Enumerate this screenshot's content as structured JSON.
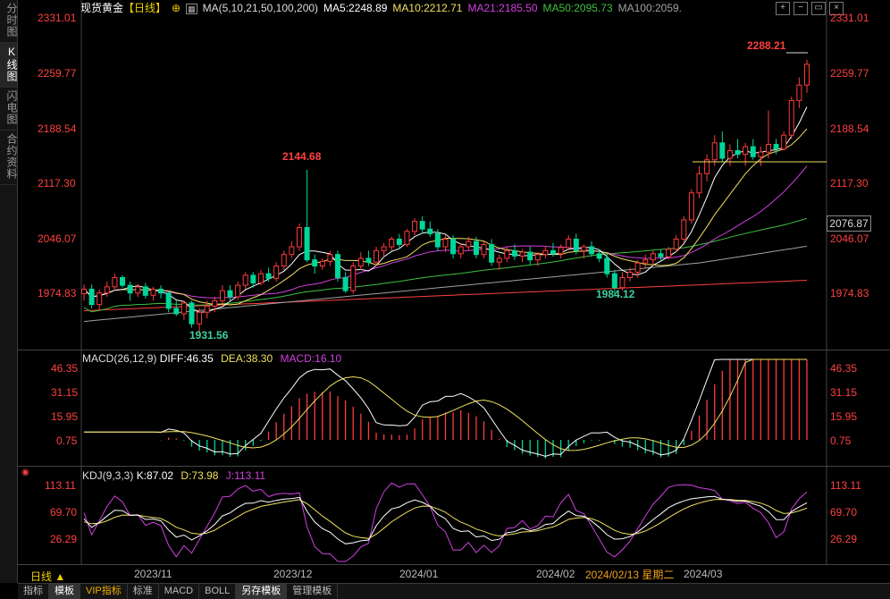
{
  "sidebar": {
    "tabs": [
      "分时图",
      "K线图",
      "闪电图",
      "合约资料"
    ],
    "active": 1
  },
  "header": {
    "title": "现货黄金",
    "period_tag": "【日线】",
    "ma_params": "MA(5,10,21,50,100,200)",
    "ma5": "MA5:2248.89",
    "ma10": "MA10:2212.71",
    "ma21": "MA21:2185.50",
    "ma50": "MA50:2095.73",
    "ma100": "MA100:2059."
  },
  "window_buttons": [
    "plus-icon",
    "minus-icon",
    "restore-icon",
    "close-icon"
  ],
  "price_axis": {
    "labels": [
      "2331.01",
      "2259.77",
      "2188.54",
      "2117.30",
      "2046.07",
      "1974.83"
    ],
    "current": "2076.87"
  },
  "annotations": {
    "high": "2288.21",
    "peak_dec": "2144.68",
    "low_nov": "1931.56",
    "low_feb": "1984.12"
  },
  "macd": {
    "title": "MACD(26,12,9)",
    "diff": "DIFF:46.35",
    "dea": "DEA:38.30",
    "macd": "MACD:16.10",
    "axis": [
      "46.35",
      "31.15",
      "15.95",
      "0.75"
    ]
  },
  "kdj": {
    "title": "KDJ(9,3,3)",
    "k": "K:87.02",
    "d": "D:73.98",
    "j": "J:113.11",
    "axis": [
      "113.11",
      "69.70",
      "26.29"
    ]
  },
  "xaxis": {
    "period": "日线 ▲",
    "labels": [
      "2023/11",
      "2023/12",
      "2024/01",
      "2024/02",
      "2024/03"
    ],
    "cursor_date": "2024/02/13 星期二"
  },
  "bottom_tabs": [
    "指标",
    "模板",
    "VIP指标",
    "标准",
    "MACD",
    "BOLL",
    "另存模板",
    "管理模板"
  ],
  "colors": {
    "up": "#ff3b3b",
    "down": "#00d69a",
    "ma5": "#ffffff",
    "ma10": "#f0e060",
    "ma21": "#d040e0",
    "ma50": "#40c040",
    "ma100": "#a0a0a0",
    "ma200": "#ff4040"
  },
  "chart_data": {
    "type": "candlestick",
    "ohlc": [
      [
        1984,
        1996,
        1975,
        1990
      ],
      [
        1990,
        1996,
        1965,
        1970
      ],
      [
        1970,
        1990,
        1962,
        1985
      ],
      [
        1985,
        2000,
        1980,
        1993
      ],
      [
        1993,
        2010,
        1988,
        2005
      ],
      [
        2005,
        2008,
        1992,
        1995
      ],
      [
        1995,
        2000,
        1975,
        1985
      ],
      [
        1985,
        1997,
        1980,
        1993
      ],
      [
        1993,
        1998,
        1978,
        1982
      ],
      [
        1982,
        1993,
        1975,
        1990
      ],
      [
        1990,
        1995,
        1978,
        1985
      ],
      [
        1985,
        1988,
        1960,
        1965
      ],
      [
        1965,
        1975,
        1955,
        1958
      ],
      [
        1958,
        1975,
        1950,
        1972
      ],
      [
        1972,
        1975,
        1940,
        1945
      ],
      [
        1945,
        1965,
        1932,
        1960
      ],
      [
        1960,
        1975,
        1952,
        1968
      ],
      [
        1968,
        1980,
        1960,
        1975
      ],
      [
        1975,
        1995,
        1970,
        1988
      ],
      [
        1988,
        1995,
        1975,
        1980
      ],
      [
        1980,
        2000,
        1976,
        1995
      ],
      [
        1995,
        2012,
        1990,
        2008
      ],
      [
        2008,
        2012,
        1992,
        1998
      ],
      [
        1998,
        2015,
        1995,
        2010
      ],
      [
        2010,
        2018,
        2000,
        2004
      ],
      [
        2004,
        2025,
        2000,
        2020
      ],
      [
        2020,
        2040,
        2015,
        2035
      ],
      [
        2035,
        2052,
        2030,
        2045
      ],
      [
        2045,
        2075,
        2040,
        2070
      ],
      [
        2070,
        2145,
        2025,
        2028
      ],
      [
        2028,
        2035,
        2010,
        2020
      ],
      [
        2020,
        2030,
        2015,
        2026
      ],
      [
        2026,
        2040,
        2020,
        2035
      ],
      [
        2035,
        2040,
        2000,
        2005
      ],
      [
        2005,
        2012,
        1985,
        1988
      ],
      [
        1988,
        2025,
        1984,
        2020
      ],
      [
        2020,
        2038,
        2015,
        2030
      ],
      [
        2030,
        2040,
        2020,
        2025
      ],
      [
        2025,
        2045,
        2020,
        2040
      ],
      [
        2040,
        2050,
        2032,
        2045
      ],
      [
        2045,
        2058,
        2040,
        2055
      ],
      [
        2055,
        2062,
        2042,
        2048
      ],
      [
        2048,
        2068,
        2045,
        2065
      ],
      [
        2065,
        2082,
        2060,
        2078
      ],
      [
        2078,
        2085,
        2062,
        2068
      ],
      [
        2068,
        2078,
        2058,
        2062
      ],
      [
        2062,
        2068,
        2040,
        2045
      ],
      [
        2045,
        2060,
        2038,
        2055
      ],
      [
        2055,
        2060,
        2030,
        2036
      ],
      [
        2036,
        2050,
        2030,
        2045
      ],
      [
        2045,
        2058,
        2040,
        2052
      ],
      [
        2052,
        2058,
        2030,
        2035
      ],
      [
        2035,
        2052,
        2030,
        2048
      ],
      [
        2048,
        2055,
        2020,
        2025
      ],
      [
        2025,
        2035,
        2015,
        2030
      ],
      [
        2030,
        2045,
        2025,
        2040
      ],
      [
        2040,
        2048,
        2028,
        2033
      ],
      [
        2033,
        2042,
        2025,
        2038
      ],
      [
        2038,
        2045,
        2022,
        2028
      ],
      [
        2028,
        2038,
        2020,
        2035
      ],
      [
        2035,
        2045,
        2030,
        2040
      ],
      [
        2040,
        2050,
        2032,
        2036
      ],
      [
        2036,
        2048,
        2030,
        2044
      ],
      [
        2044,
        2060,
        2040,
        2055
      ],
      [
        2055,
        2062,
        2035,
        2040
      ],
      [
        2040,
        2048,
        2030,
        2045
      ],
      [
        2045,
        2052,
        2032,
        2036
      ],
      [
        2036,
        2042,
        2025,
        2030
      ],
      [
        2030,
        2035,
        2005,
        2010
      ],
      [
        2010,
        2015,
        1984,
        1992
      ],
      [
        1992,
        2012,
        1988,
        2005
      ],
      [
        2005,
        2018,
        2000,
        2012
      ],
      [
        2012,
        2028,
        2005,
        2024
      ],
      [
        2024,
        2035,
        2018,
        2028
      ],
      [
        2028,
        2040,
        2020,
        2036
      ],
      [
        2036,
        2042,
        2028,
        2032
      ],
      [
        2032,
        2045,
        2028,
        2042
      ],
      [
        2042,
        2060,
        2038,
        2055
      ],
      [
        2055,
        2085,
        2050,
        2080
      ],
      [
        2080,
        2120,
        2075,
        2115
      ],
      [
        2115,
        2150,
        2108,
        2140
      ],
      [
        2140,
        2165,
        2130,
        2158
      ],
      [
        2158,
        2190,
        2150,
        2180
      ],
      [
        2180,
        2195,
        2155,
        2160
      ],
      [
        2160,
        2178,
        2150,
        2170
      ],
      [
        2170,
        2185,
        2160,
        2165
      ],
      [
        2165,
        2180,
        2150,
        2175
      ],
      [
        2175,
        2185,
        2158,
        2162
      ],
      [
        2162,
        2175,
        2150,
        2168
      ],
      [
        2168,
        2222,
        2160,
        2178
      ],
      [
        2178,
        2185,
        2165,
        2172
      ],
      [
        2172,
        2195,
        2170,
        2190
      ],
      [
        2190,
        2240,
        2185,
        2235
      ],
      [
        2235,
        2265,
        2225,
        2255
      ],
      [
        2255,
        2288,
        2245,
        2282
      ]
    ],
    "price_range": [
      1915,
      2340
    ]
  }
}
